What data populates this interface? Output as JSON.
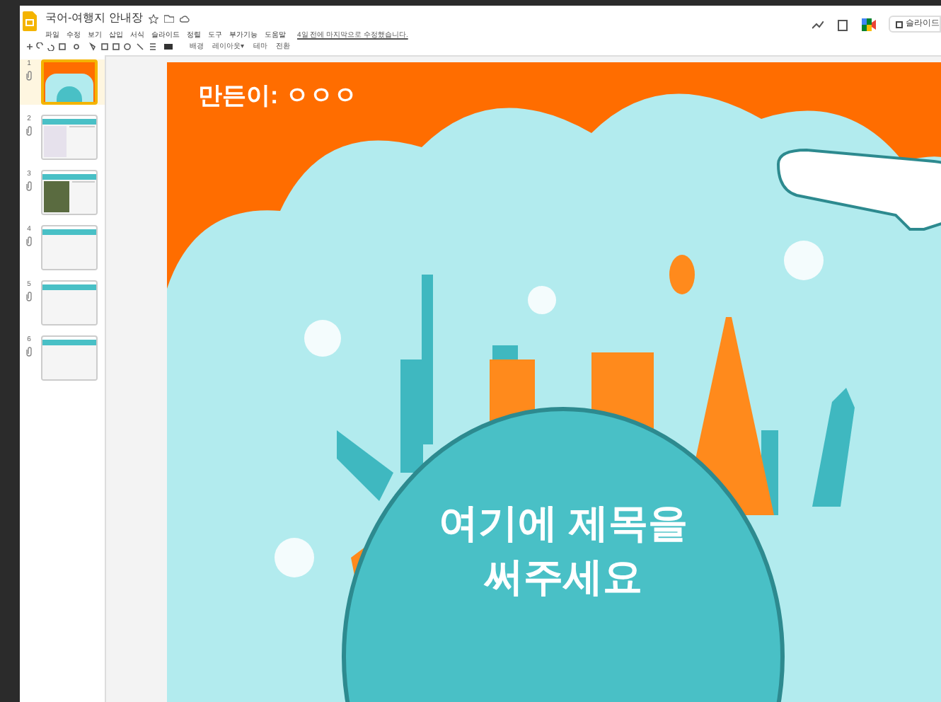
{
  "doc": {
    "title": "국어-여행지 안내장",
    "last_edit": "4일 전에 마지막으로 수정했습니다."
  },
  "menu": [
    "파일",
    "수정",
    "보기",
    "삽입",
    "서식",
    "슬라이드",
    "정렬",
    "도구",
    "부가기능",
    "도움말"
  ],
  "toolbar": [
    "배경",
    "레이아웃▾",
    "테마",
    "전환"
  ],
  "header_button": "슬라이드",
  "slides": [
    {
      "number": "1",
      "kind": "title",
      "selected": true
    },
    {
      "number": "2",
      "kind": "map",
      "selected": false
    },
    {
      "number": "3",
      "kind": "photo",
      "selected": false
    },
    {
      "number": "4",
      "kind": "two_column",
      "selected": false
    },
    {
      "number": "5",
      "kind": "two_column",
      "selected": false
    },
    {
      "number": "6",
      "kind": "list",
      "selected": false
    }
  ],
  "slide": {
    "author": "만든이: ㅇㅇㅇ",
    "title_lines": [
      "여기에 제목을",
      "써주세요"
    ]
  }
}
